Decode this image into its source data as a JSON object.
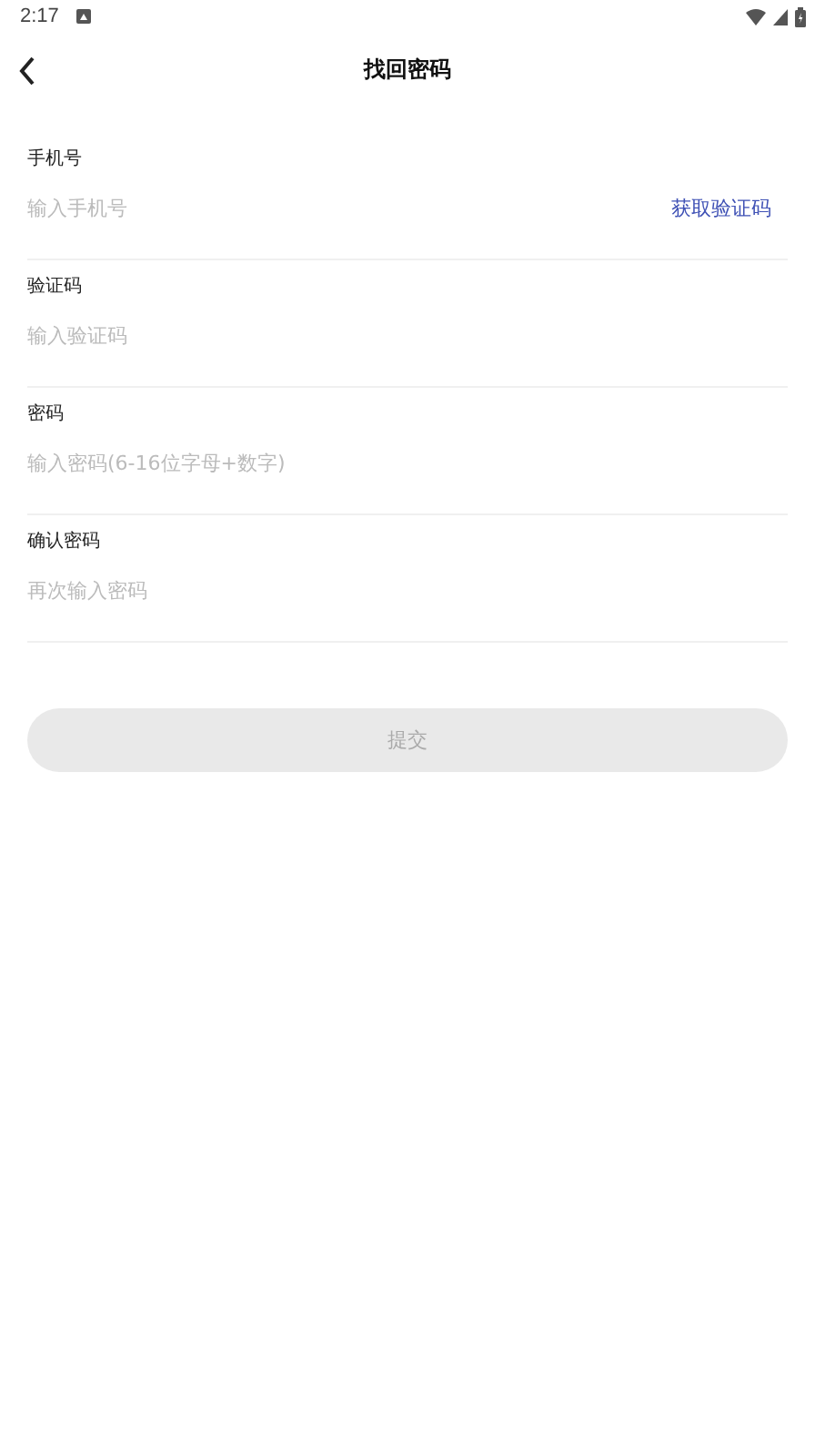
{
  "status_bar": {
    "time": "2:17"
  },
  "header": {
    "title": "找回密码"
  },
  "fields": [
    {
      "label": "手机号",
      "placeholder": "输入手机号",
      "action": "获取验证码"
    },
    {
      "label": "验证码",
      "placeholder": "输入验证码"
    },
    {
      "label": "密码",
      "placeholder": "输入密码(6-16位字母+数字)"
    },
    {
      "label": "确认密码",
      "placeholder": "再次输入密码"
    }
  ],
  "submit": {
    "label": "提交",
    "disabled": true
  }
}
